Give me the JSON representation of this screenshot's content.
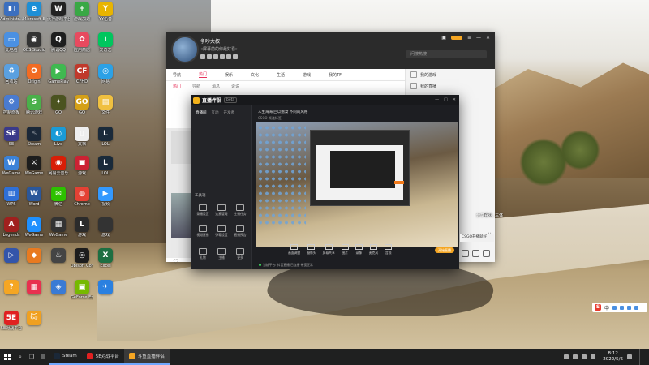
{
  "desktop": {
    "icons": [
      {
        "label": "Administr...",
        "color": "#3b6fbf",
        "glyph": "◧"
      },
      {
        "label": "Microsoft Edge",
        "color": "#1d8fd6",
        "glyph": "e"
      },
      {
        "label": "沃神游戏平台",
        "color": "#222222",
        "glyph": "W"
      },
      {
        "label": "游戏加速",
        "color": "#39a845",
        "glyph": "+"
      },
      {
        "label": "YY语音",
        "color": "#e8b400",
        "glyph": "Y"
      },
      {
        "label": "此电脑",
        "color": "#4a90e2",
        "glyph": "▭"
      },
      {
        "label": "OBS Studio",
        "color": "#333333",
        "glyph": "◉"
      },
      {
        "label": "腾讯QQ",
        "color": "#1e1e1e",
        "glyph": "Q"
      },
      {
        "label": "应用商店",
        "color": "#e84a5f",
        "glyph": "✿"
      },
      {
        "label": "爱奇艺",
        "color": "#00c65e",
        "glyph": "i"
      },
      {
        "label": "回收站",
        "color": "#5aa0e0",
        "glyph": "♻"
      },
      {
        "label": "Origin",
        "color": "#f26b22",
        "glyph": "O"
      },
      {
        "label": "GamePlay",
        "color": "#3fb950",
        "glyph": "▶"
      },
      {
        "label": "CFHD",
        "color": "#c0392b",
        "glyph": "CF"
      },
      {
        "label": "网易",
        "color": "#2ba1e6",
        "glyph": "◎"
      },
      {
        "label": "控制面板",
        "color": "#4a7bd0",
        "glyph": "⚙"
      },
      {
        "label": "腾讯游戏",
        "color": "#4ab04a",
        "glyph": "S"
      },
      {
        "label": "GO",
        "color": "#4b5320",
        "glyph": "✦"
      },
      {
        "label": "GO",
        "color": "#d4a017",
        "glyph": "GO"
      },
      {
        "label": "文件",
        "color": "#f0c040",
        "glyph": "▤"
      },
      {
        "label": "SE",
        "color": "#3a3a8a",
        "glyph": "SE"
      },
      {
        "label": "Steam",
        "color": "#1b2838",
        "glyph": "♨"
      },
      {
        "label": "Live",
        "color": "#1a9bd7",
        "glyph": "◐"
      },
      {
        "label": "文档",
        "color": "#eeeeee",
        "glyph": "▯"
      },
      {
        "label": "LOL",
        "color": "#1a2a3a",
        "glyph": "L"
      },
      {
        "label": "WeGame",
        "color": "#3b82d8",
        "glyph": "W"
      },
      {
        "label": "WeGame",
        "color": "#1d1d1d",
        "glyph": "⚔"
      },
      {
        "label": "网易云音乐",
        "color": "#d81e06",
        "glyph": "◉"
      },
      {
        "label": "游戏",
        "color": "#c23",
        "glyph": "▣"
      },
      {
        "label": "LOL",
        "color": "#1a2a3a",
        "glyph": "L"
      },
      {
        "label": "WPS",
        "color": "#2f6fd6",
        "glyph": "▥"
      },
      {
        "label": "Word",
        "color": "#2b579a",
        "glyph": "W"
      },
      {
        "label": "微信",
        "color": "#2dc100",
        "glyph": "✉"
      },
      {
        "label": "Chrome",
        "color": "#e44134",
        "glyph": "◍"
      },
      {
        "label": "视频",
        "color": "#3399ff",
        "glyph": "▶"
      },
      {
        "label": "Legends",
        "color": "#a0201e",
        "glyph": "A"
      },
      {
        "label": "WeGame",
        "color": "#1e90ff",
        "glyph": "A"
      },
      {
        "label": "WeGame",
        "color": "#333333",
        "glyph": "▦"
      },
      {
        "label": "游戏",
        "color": "#2b2b2b",
        "glyph": "L"
      },
      {
        "label": "游戏",
        "color": "#333333",
        "glyph": ""
      },
      {
        "label": "",
        "color": "#3355aa",
        "glyph": "▷"
      },
      {
        "label": "",
        "color": "#e87a20",
        "glyph": "◆"
      },
      {
        "label": "",
        "color": "#444",
        "glyph": "♨"
      },
      {
        "label": "Ubisoft Connect",
        "color": "#1d1d1d",
        "glyph": "◎"
      },
      {
        "label": "Excel",
        "color": "#1d6f42",
        "glyph": "X"
      },
      {
        "label": "",
        "color": "#f5a623",
        "glyph": "?"
      },
      {
        "label": "",
        "color": "#e8304f",
        "glyph": "▦"
      },
      {
        "label": "",
        "color": "#3a7bd5",
        "glyph": "◈"
      },
      {
        "label": "GeForce Experience",
        "color": "#76b900",
        "glyph": "▣"
      },
      {
        "label": "",
        "color": "#2a80e0",
        "glyph": "✈"
      },
      {
        "label": "5E对战平台",
        "color": "#e02020",
        "glyph": "5E"
      },
      {
        "label": "",
        "color": "#f0a020",
        "glyph": "🐱"
      }
    ]
  },
  "qq_window": {
    "username": "争吵大叔",
    "signature": "«屏幕前的你最好看»",
    "search_placeholder": "问搜热搜",
    "nav": [
      "导航",
      "热门",
      "娱乐",
      "文化",
      "生活",
      "游戏",
      "我的TF"
    ],
    "nav_active": 1,
    "subnav": [
      "热门",
      "导航",
      "消息",
      "说说"
    ],
    "subnav_active": 0,
    "right_panel": [
      "我的游戏",
      "我的直播"
    ],
    "right_text1": "直播",
    "right_text2": "分",
    "like_icon": "♡",
    "feed_text": "设置"
  },
  "live_app": {
    "name": "直播伴侣",
    "version": "beta",
    "side_tabs": [
      "直播间",
      "互动",
      "开发者"
    ],
    "side_tabs_active": 0,
    "tools_title": "工具箱",
    "tools": [
      {
        "label": "录播设置"
      },
      {
        "label": "连麦管理"
      },
      {
        "label": "主播任务"
      },
      {
        "label": "视频直播"
      },
      {
        "label": "弹幕设置"
      },
      {
        "label": "直播预告"
      },
      {
        "label": "礼物"
      },
      {
        "label": "主播"
      },
      {
        "label": "更多"
      }
    ],
    "room_title": "人生海海 回以赠汝 不同的风格",
    "room_sub": "CSGO  频道标签",
    "toolbar": [
      "画面调整",
      "摄像头",
      "屏幕共享",
      "图片",
      "录像",
      "麦克风",
      "音频"
    ],
    "go_live": "开始直播",
    "status": "当前平台: 抖音直播  已连接  带宽正常",
    "controls": [
      "—",
      "□",
      "✕"
    ]
  },
  "overlay": {
    "side_text": "分享喜欢, 三体",
    "side_box": "CSGO开播就好"
  },
  "ime": {
    "brand": "S",
    "lang": "中"
  },
  "taskbar": {
    "tasks": [
      {
        "label": "Steam",
        "color": "#1b2838",
        "active": false
      },
      {
        "label": "5E对战平台",
        "color": "#e02020",
        "active": false
      },
      {
        "label": "斗鱼直播伴侣",
        "color": "#f5a623",
        "active": true
      }
    ],
    "time": "8:12",
    "date": "2022/5/6"
  }
}
